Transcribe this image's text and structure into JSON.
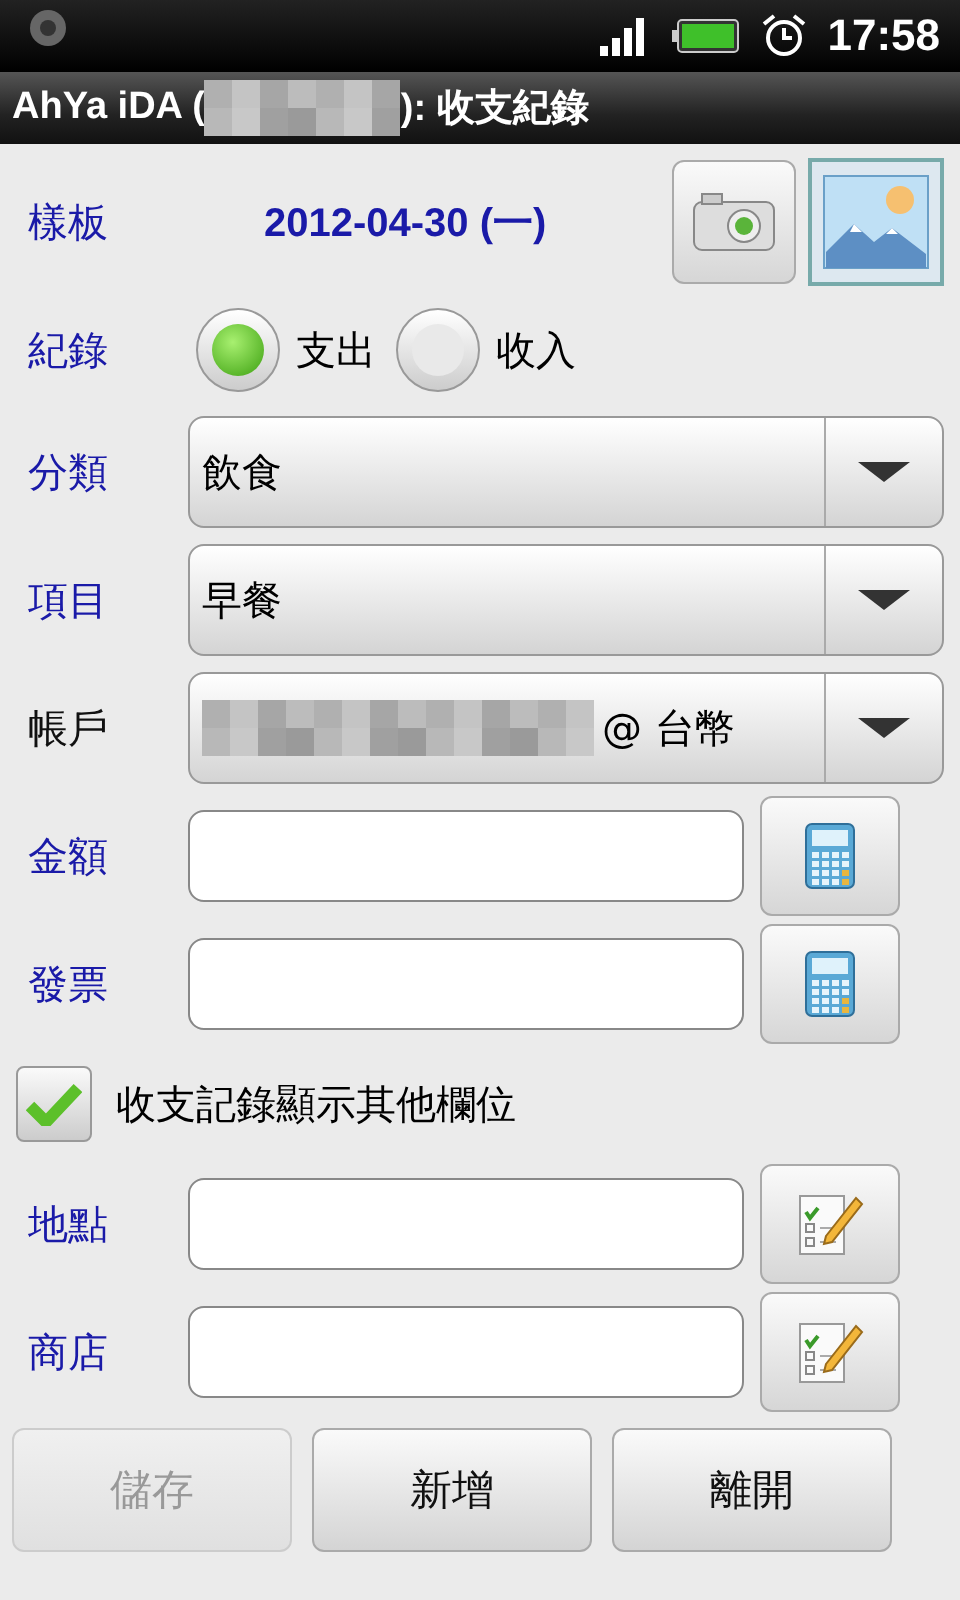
{
  "status_bar": {
    "time": "17:58"
  },
  "title_bar": {
    "prefix": "AhYa iDA (",
    "redacted": true,
    "suffix": "): 收支紀錄"
  },
  "template": {
    "label": "樣板",
    "required": true,
    "date": "2012-04-30 (一)"
  },
  "record": {
    "label": "紀錄",
    "required": true,
    "options": [
      {
        "label": "支出",
        "selected": true
      },
      {
        "label": "收入",
        "selected": false
      }
    ]
  },
  "dropdowns": [
    {
      "label": "分類",
      "required": true,
      "redacted": false,
      "value": "飲食"
    },
    {
      "label": "項目",
      "required": true,
      "redacted": false,
      "value": "早餐"
    },
    {
      "label": "帳戶",
      "required": false,
      "redacted": true,
      "value": "@ 台幣"
    }
  ],
  "fields_top": [
    {
      "label": "金額",
      "required": true,
      "kind": "calc"
    },
    {
      "label": "發票",
      "required": true,
      "kind": "calc"
    }
  ],
  "show_more": {
    "label": "收支記錄顯示其他欄位",
    "checked": true
  },
  "fields_bottom": [
    {
      "label": "地點",
      "required": true,
      "kind": "pick"
    },
    {
      "label": "商店",
      "required": true,
      "kind": "pick"
    }
  ],
  "buttons": [
    {
      "label": "儲存",
      "disabled": true
    },
    {
      "label": "新增",
      "disabled": false
    },
    {
      "label": "離開",
      "disabled": false
    }
  ]
}
